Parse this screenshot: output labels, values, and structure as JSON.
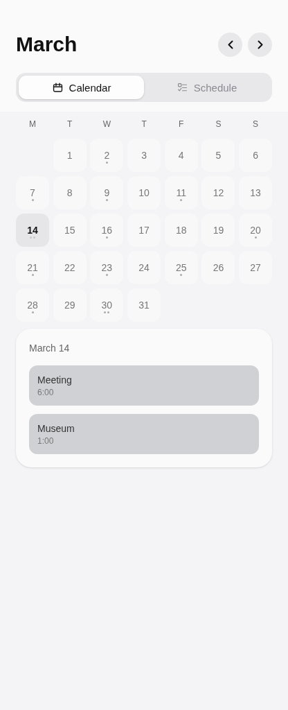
{
  "header": {
    "title": "March"
  },
  "tabs": [
    {
      "label": "Calendar",
      "selected": true
    },
    {
      "label": "Schedule",
      "selected": false
    }
  ],
  "weekdays": [
    "M",
    "T",
    "W",
    "T",
    "F",
    "S",
    "S"
  ],
  "days": [
    {
      "kind": "blank"
    },
    {
      "kind": "day",
      "label": "1",
      "event_dot": false,
      "second_dot": false,
      "selected": false
    },
    {
      "kind": "day",
      "label": "2",
      "event_dot": true,
      "second_dot": false,
      "selected": false
    },
    {
      "kind": "day",
      "label": "3",
      "event_dot": false,
      "second_dot": false,
      "selected": false
    },
    {
      "kind": "day",
      "label": "4",
      "event_dot": false,
      "second_dot": false,
      "selected": false
    },
    {
      "kind": "day",
      "label": "5",
      "event_dot": false,
      "second_dot": false,
      "selected": false
    },
    {
      "kind": "day",
      "label": "6",
      "event_dot": false,
      "second_dot": false,
      "selected": false
    },
    {
      "kind": "day",
      "label": "7",
      "event_dot": true,
      "second_dot": false,
      "selected": false
    },
    {
      "kind": "day",
      "label": "8",
      "event_dot": false,
      "second_dot": false,
      "selected": false
    },
    {
      "kind": "day",
      "label": "9",
      "event_dot": true,
      "second_dot": false,
      "selected": false
    },
    {
      "kind": "day",
      "label": "10",
      "event_dot": false,
      "second_dot": false,
      "selected": false
    },
    {
      "kind": "day",
      "label": "11",
      "event_dot": true,
      "second_dot": false,
      "selected": false
    },
    {
      "kind": "day",
      "label": "12",
      "event_dot": false,
      "second_dot": false,
      "selected": false
    },
    {
      "kind": "day",
      "label": "13",
      "event_dot": false,
      "second_dot": false,
      "selected": false
    },
    {
      "kind": "day",
      "label": "14",
      "event_dot": true,
      "second_dot": true,
      "selected": true
    },
    {
      "kind": "day",
      "label": "15",
      "event_dot": false,
      "second_dot": false,
      "selected": false
    },
    {
      "kind": "day",
      "label": "16",
      "event_dot": true,
      "second_dot": false,
      "selected": false
    },
    {
      "kind": "day",
      "label": "17",
      "event_dot": false,
      "second_dot": false,
      "selected": false
    },
    {
      "kind": "day",
      "label": "18",
      "event_dot": false,
      "second_dot": false,
      "selected": false
    },
    {
      "kind": "day",
      "label": "19",
      "event_dot": false,
      "second_dot": false,
      "selected": false
    },
    {
      "kind": "day",
      "label": "20",
      "event_dot": true,
      "second_dot": false,
      "selected": false
    },
    {
      "kind": "day",
      "label": "21",
      "event_dot": true,
      "second_dot": false,
      "selected": false
    },
    {
      "kind": "day",
      "label": "22",
      "event_dot": false,
      "second_dot": false,
      "selected": false
    },
    {
      "kind": "day",
      "label": "23",
      "event_dot": true,
      "second_dot": false,
      "selected": false
    },
    {
      "kind": "day",
      "label": "24",
      "event_dot": false,
      "second_dot": false,
      "selected": false
    },
    {
      "kind": "day",
      "label": "25",
      "event_dot": true,
      "second_dot": false,
      "selected": false
    },
    {
      "kind": "day",
      "label": "26",
      "event_dot": false,
      "second_dot": false,
      "selected": false
    },
    {
      "kind": "day",
      "label": "27",
      "event_dot": false,
      "second_dot": false,
      "selected": false
    },
    {
      "kind": "day",
      "label": "28",
      "event_dot": true,
      "second_dot": false,
      "selected": false
    },
    {
      "kind": "day",
      "label": "29",
      "event_dot": false,
      "second_dot": false,
      "selected": false
    },
    {
      "kind": "day",
      "label": "30",
      "event_dot": true,
      "second_dot": true,
      "selected": false
    },
    {
      "kind": "day",
      "label": "31",
      "event_dot": false,
      "second_dot": false,
      "selected": false
    }
  ],
  "agenda": {
    "date": "March 14",
    "events": [
      {
        "title": "Meeting",
        "time": "6:00"
      },
      {
        "title": "Museum",
        "time": "1:00"
      }
    ]
  }
}
